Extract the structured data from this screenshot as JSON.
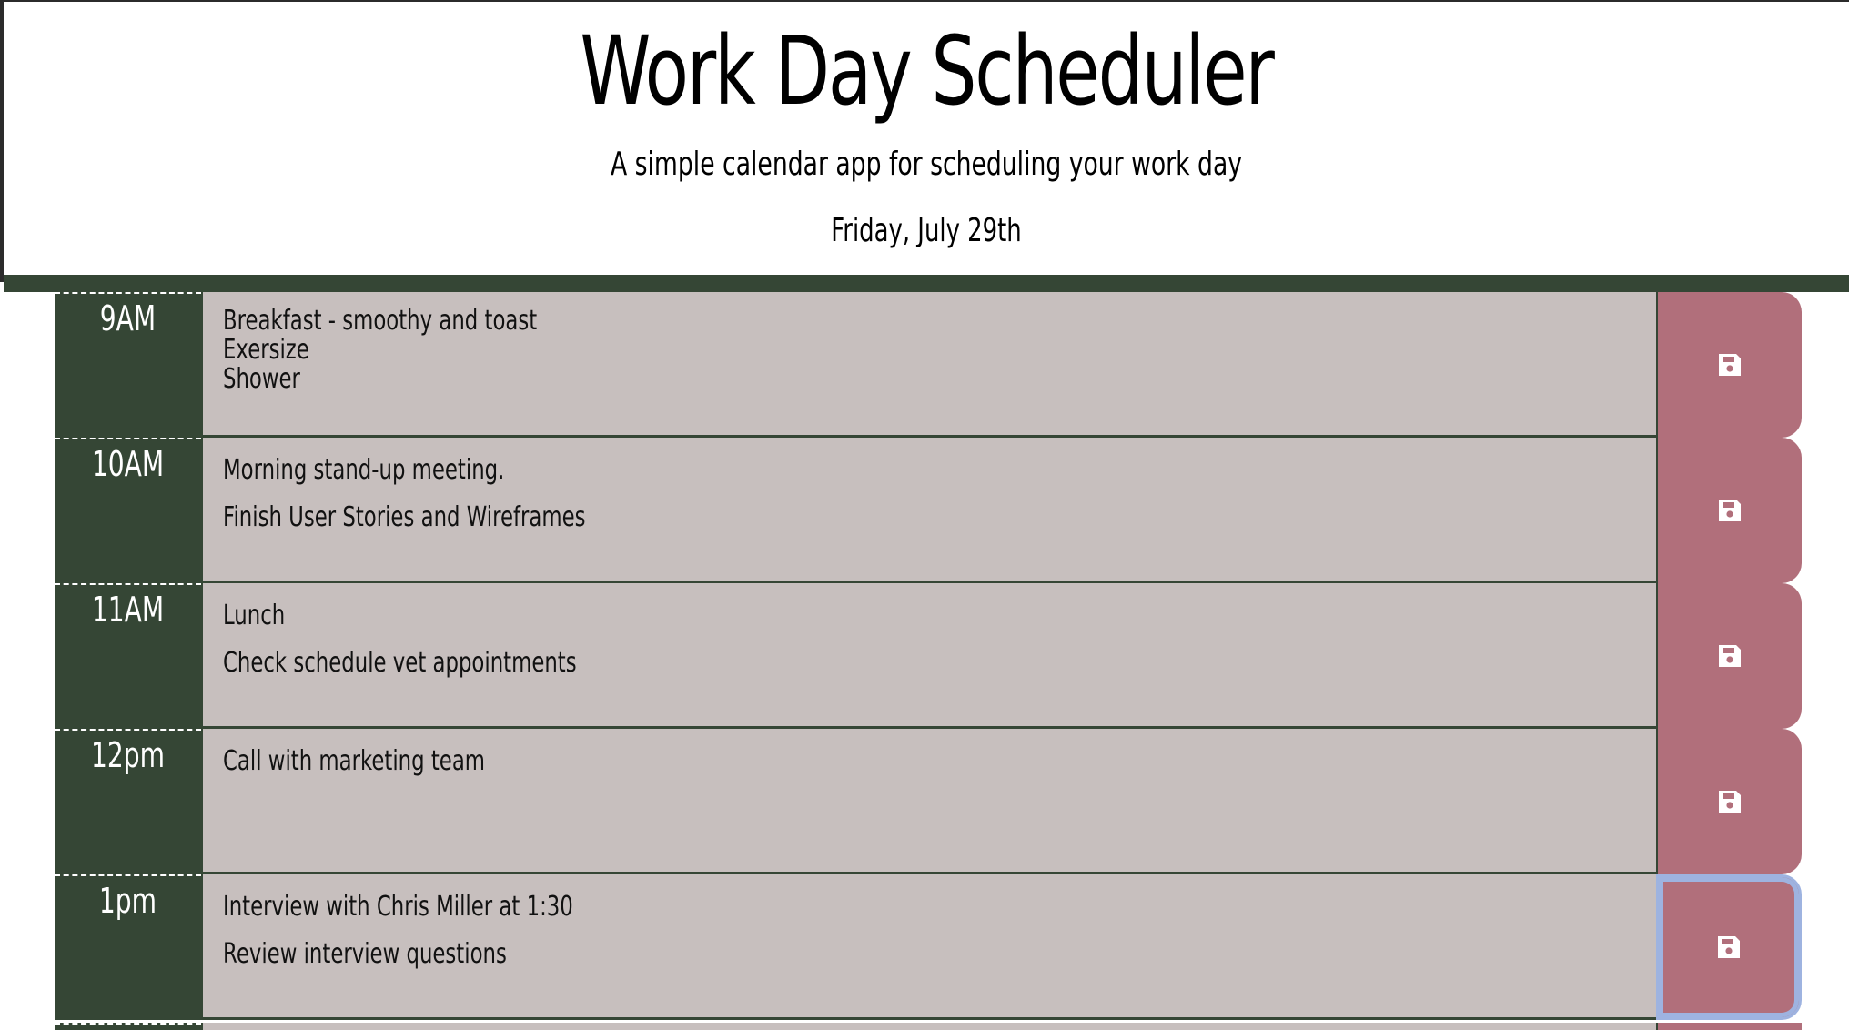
{
  "header": {
    "title": "Work Day Scheduler",
    "subtitle": "A simple calendar app for scheduling your work day",
    "current_day": "Friday, July 29th"
  },
  "colors": {
    "accent_dark_green": "#354635",
    "description_bg": "#c7bfbe",
    "save_button_bg": "#b16f7b",
    "focus_ring": "#9eb3e0"
  },
  "time_blocks": [
    {
      "hour": "9AM",
      "lines": [
        "Breakfast - smoothy and toast",
        "Exersize",
        "Shower"
      ],
      "save_icon": "floppy-disk-icon"
    },
    {
      "hour": "10AM",
      "lines": [
        "Morning stand-up meeting.",
        "Finish User Stories and Wireframes"
      ],
      "save_icon": "floppy-disk-icon"
    },
    {
      "hour": "11AM",
      "lines": [
        "Lunch",
        "Check schedule vet appointments"
      ],
      "save_icon": "floppy-disk-icon"
    },
    {
      "hour": "12pm",
      "lines": [
        "Call with marketing team"
      ],
      "save_icon": "floppy-disk-icon"
    },
    {
      "hour": "1pm",
      "lines": [
        "Interview with Chris Miller at 1:30",
        "Review interview questions"
      ],
      "save_icon": "floppy-disk-icon"
    }
  ]
}
